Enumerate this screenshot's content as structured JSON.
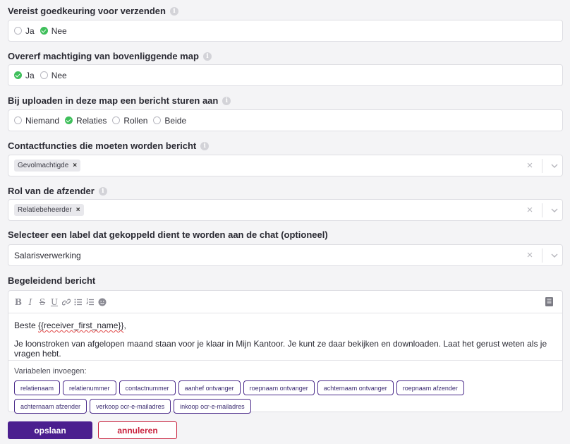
{
  "fields": {
    "approval": {
      "label": "Vereist goedkeuring voor verzenden",
      "options": [
        {
          "label": "Ja",
          "checked": false
        },
        {
          "label": "Nee",
          "checked": true
        }
      ]
    },
    "inherit": {
      "label": "Overerf machtiging van bovenliggende map",
      "options": [
        {
          "label": "Ja",
          "checked": true
        },
        {
          "label": "Nee",
          "checked": false
        }
      ]
    },
    "upload_notify": {
      "label": "Bij uploaden in deze map een bericht sturen aan",
      "options": [
        {
          "label": "Niemand",
          "checked": false
        },
        {
          "label": "Relaties",
          "checked": true
        },
        {
          "label": "Rollen",
          "checked": false
        },
        {
          "label": "Beide",
          "checked": false
        }
      ]
    },
    "contact_functions": {
      "label": "Contactfuncties die moeten worden bericht",
      "tags": [
        "Gevolmachtigde"
      ]
    },
    "sender_role": {
      "label": "Rol van de afzender",
      "tags": [
        "Relatiebeheerder"
      ]
    },
    "chat_label": {
      "label": "Selecteer een label dat gekoppeld dient te worden aan de chat (optioneel)",
      "value": "Salarisverwerking"
    },
    "message": {
      "label": "Begeleidend bericht",
      "greeting_prefix": "Beste ",
      "greeting_placeholder": "{{receiver_first_name}}",
      "greeting_suffix": ",",
      "body": "Je loonstroken van afgelopen maand staan voor je klaar in Mijn Kantoor. Je kunt ze daar bekijken en downloaden. Laat het gerust weten als je vragen hebt.",
      "variables_title": "Variabelen invoegen:",
      "variables": [
        "relatienaam",
        "relatienummer",
        "contactnummer",
        "aanhef ontvanger",
        "roepnaam ontvanger",
        "achternaam ontvanger",
        "roepnaam afzender",
        "achternaam afzender",
        "verkoop ocr-e-mailadres",
        "inkoop ocr-e-mailadres"
      ]
    }
  },
  "icons": {
    "info": "info-icon",
    "checked_radio": "check-circle-icon",
    "clear": "close-icon",
    "dropdown": "chevron-down-icon"
  },
  "colors": {
    "primary": "#4b1f8f",
    "danger": "#c8203c",
    "checked": "#3fbf5b"
  },
  "actions": {
    "save": "opslaan",
    "cancel": "annuleren"
  }
}
